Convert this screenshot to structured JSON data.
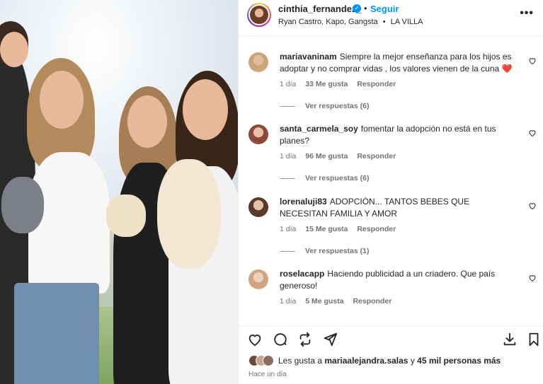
{
  "post": {
    "username": "cinthia_fernandez_",
    "verified": true,
    "follow_label": "Seguir",
    "audio": "Ryan Castro, Kapo, Gangsta",
    "location": "LA VILLA",
    "audio_sep": "•"
  },
  "comments": [
    {
      "user": "mariavaninam",
      "text": "Siempre la mejor enseñanza para los hijos es adoptar y no comprar vidas , los valores vienen de la cuna",
      "emoji": "❤️",
      "time": "1 día",
      "likes": "33 Me gusta",
      "reply_label": "Responder",
      "view_replies": "Ver respuestas (6)"
    },
    {
      "user": "santa_carmela_soy",
      "text": "fomentar la adopción no está en tus planes?",
      "emoji": "",
      "time": "1 día",
      "likes": "96 Me gusta",
      "reply_label": "Responder",
      "view_replies": "Ver respuestas (6)"
    },
    {
      "user": "lorenaluji83",
      "text": "ADOPCIÓN... TANTOS BEBES QUE NECESITAN FAMILIA Y AMOR",
      "emoji": "",
      "time": "1 día",
      "likes": "15 Me gusta",
      "reply_label": "Responder",
      "view_replies": "Ver respuestas (1)"
    },
    {
      "user": "roselacapp",
      "text": "Haciendo publicidad a un criadero. Que país generoso!",
      "emoji": "",
      "time": "1 día",
      "likes": "5 Me gusta",
      "reply_label": "Responder",
      "view_replies": ""
    }
  ],
  "likes": {
    "prefix": "Les gusta a",
    "user": "mariaalejandra.salas",
    "middle": "y",
    "count": "45 mil personas más"
  },
  "posted": "Hace un día",
  "colors": {
    "accent": "#0095f6",
    "text": "#262626",
    "muted": "#737373",
    "heart": "#e0245e"
  },
  "icons": [
    "heart-icon",
    "comment-icon",
    "repost-icon",
    "share-icon",
    "download-icon",
    "bookmark-icon",
    "more-icon",
    "verified-icon"
  ]
}
